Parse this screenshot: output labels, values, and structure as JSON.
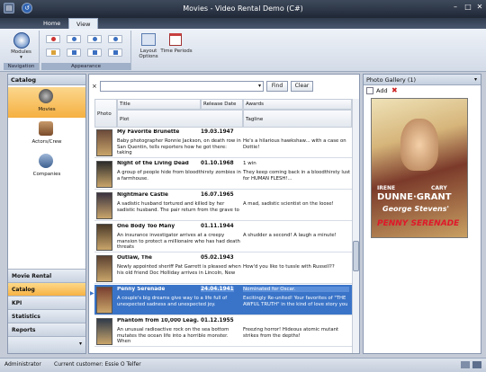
{
  "window": {
    "title": "Movies - Video Rental Demo (C#)"
  },
  "ribbon": {
    "tabs": [
      "Home",
      "View"
    ],
    "modules_label": "Modules",
    "layout_label": "Layout Options",
    "periods_label": "Time Periods",
    "groups": [
      "Navigation",
      "Appearance"
    ]
  },
  "catalog": {
    "title": "Catalog",
    "items": [
      "Movies",
      "Actors/Crew",
      "Companies"
    ],
    "nav": [
      "Movie Rental",
      "Catalog",
      "KPI",
      "Statistics",
      "Reports"
    ]
  },
  "search": {
    "find_label": "Find",
    "clear_label": "Clear",
    "close": "×"
  },
  "grid": {
    "headers": {
      "photo": "Photo",
      "title": "Title",
      "release": "Release Date",
      "awards": "Awards",
      "plot": "Plot",
      "tagline": "Tagline"
    },
    "rows": [
      {
        "title": "My Favorite Brunette",
        "date": "19.03.1947",
        "awards": "",
        "plot": "Baby photographer Ronnie Jackson, on death row in San Quentin, tells reporters how he got there: taking",
        "tagline": "He's a hilarious hawkshaw... with a case on Dottie!"
      },
      {
        "title": "Night of the Living Dead",
        "date": "01.10.1968",
        "awards": "1 win",
        "plot": "A group of people hide from bloodthirsty zombies in a farmhouse.",
        "tagline": "They keep coming back in a bloodthirsty lust for HUMAN FLESH!..."
      },
      {
        "title": "Nightmare Castle",
        "date": "16.07.1965",
        "awards": "",
        "plot": "A sadistic husband tortured and killed by her sadistic husband. The pair return from the grave to",
        "tagline": "A mad, sadistic scientist on the loose!"
      },
      {
        "title": "One Body Too Many",
        "date": "01.11.1944",
        "awards": "",
        "plot": "An insurance investigator arrives at a creepy mansion to protect a millionaire who has had death threats",
        "tagline": "A shudder a second! A laugh a minute!"
      },
      {
        "title": "Outlaw, The",
        "date": "05.02.1943",
        "awards": "",
        "plot": "Newly appointed sheriff Pat Garrett is pleased when his old friend Doc Holliday arrives in Lincoln, New",
        "tagline": "How'd you like to tussle with Russell??"
      },
      {
        "title": "Penny Serenade",
        "date": "24.04.1941",
        "awards": "Nominated for Oscar.",
        "plot": "A couple's big dreams give way to a life full of unexpected sadness and unexpected joy.",
        "tagline": "Excitingly Re-united! Your favorites of \"THE AWFUL TRUTH\" in the kind of love story you"
      },
      {
        "title": "Phantom from 10,000 Leag...",
        "date": "01.12.1955",
        "awards": "",
        "plot": "An unusual radioactive rock on the sea bottom mutates the ocean life into a horrible monster. When",
        "tagline": "Freezing horror! Hideous atomic mutant strikes from the depths!"
      }
    ]
  },
  "gallery": {
    "title": "Photo Gallery (1)",
    "add_label": "Add",
    "poster_lines": [
      "IRENE",
      "CARY",
      "DUNNE·GRANT",
      "George Stevens'",
      "PENNY SERENADE"
    ]
  },
  "status": {
    "user": "Administrator",
    "customer": "Current customer: Essie O Telfer"
  }
}
